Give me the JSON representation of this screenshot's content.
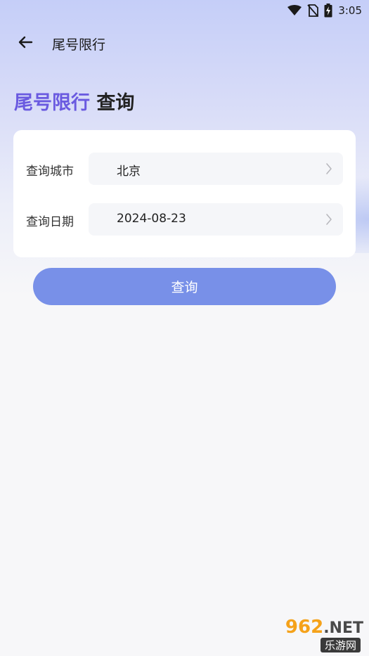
{
  "status_bar": {
    "time": "3:05",
    "icons": [
      "wifi-icon",
      "no-sim-icon",
      "battery-charging-icon"
    ]
  },
  "nav": {
    "title": "尾号限行",
    "back_icon": "arrow-left-icon"
  },
  "heading": {
    "accent": "尾号限行",
    "rest": "查询"
  },
  "form": {
    "rows": [
      {
        "label": "查询城市",
        "value": "北京",
        "icon": "chevron-right-icon"
      },
      {
        "label": "查询日期",
        "value": "2024-08-23",
        "icon": "chevron-right-icon"
      }
    ]
  },
  "button": {
    "label": "查询"
  },
  "watermark": {
    "brand_num": "962",
    "brand_suffix": ".NET",
    "sub": "乐游网"
  },
  "colors": {
    "accent": "#6a5ae0",
    "button": "#7890e8",
    "background": "#f7f7f9"
  }
}
